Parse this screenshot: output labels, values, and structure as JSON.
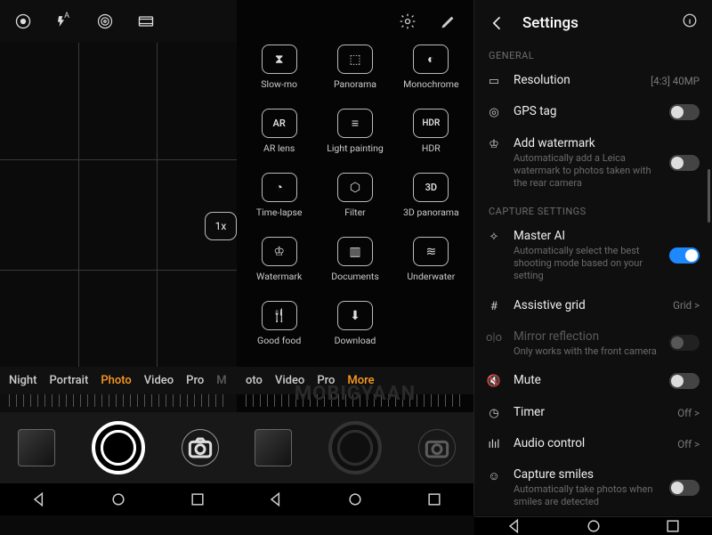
{
  "left": {
    "zoom_label": "1x",
    "modes": [
      "Night",
      "Portrait",
      "Photo",
      "Video",
      "Pro"
    ],
    "active_mode_index": 2
  },
  "mid": {
    "modes_strip": [
      "oto",
      "Video",
      "Pro",
      "More"
    ],
    "active_mode_index": 3,
    "grid": [
      {
        "icon": "hourglass",
        "label": "Slow-mo"
      },
      {
        "icon": "panorama",
        "label": "Panorama"
      },
      {
        "icon": "mono",
        "label": "Monochrome"
      },
      {
        "icon": "ar",
        "label": "AR lens"
      },
      {
        "icon": "lightpaint",
        "label": "Light painting"
      },
      {
        "icon": "hdr",
        "label": "HDR"
      },
      {
        "icon": "timelapse",
        "label": "Time-lapse"
      },
      {
        "icon": "filter",
        "label": "Filter"
      },
      {
        "icon": "3d",
        "label": "3D panorama"
      },
      {
        "icon": "watermark",
        "label": "Watermark"
      },
      {
        "icon": "documents",
        "label": "Documents"
      },
      {
        "icon": "underwater",
        "label": "Underwater"
      },
      {
        "icon": "food",
        "label": "Good food"
      },
      {
        "icon": "download",
        "label": "Download"
      }
    ],
    "watermark_text": "MOBIGYAAN"
  },
  "right": {
    "title": "Settings",
    "sections": {
      "general": {
        "label": "GENERAL",
        "rows": [
          {
            "key": "resolution",
            "title": "Resolution",
            "value": "[4:3] 40MP"
          },
          {
            "key": "gps",
            "title": "GPS tag",
            "toggle": false
          },
          {
            "key": "watermark",
            "title": "Add watermark",
            "desc": "Automatically add a Leica watermark to photos taken with the rear camera",
            "toggle": false
          }
        ]
      },
      "capture": {
        "label": "CAPTURE SETTINGS",
        "rows": [
          {
            "key": "master_ai",
            "title": "Master AI",
            "desc": "Automatically select the best shooting mode based on your setting",
            "toggle": true
          },
          {
            "key": "grid",
            "title": "Assistive grid",
            "value": "Grid >"
          },
          {
            "key": "mirror",
            "title": "Mirror reflection",
            "desc": "Only works with the front camera",
            "toggle": false,
            "disabled": true
          },
          {
            "key": "mute",
            "title": "Mute",
            "toggle": false
          },
          {
            "key": "timer",
            "title": "Timer",
            "value": "Off >"
          },
          {
            "key": "audio",
            "title": "Audio control",
            "value": "Off >"
          },
          {
            "key": "smiles",
            "title": "Capture smiles",
            "desc": "Automatically take photos when smiles are detected",
            "toggle": false
          }
        ]
      }
    }
  }
}
